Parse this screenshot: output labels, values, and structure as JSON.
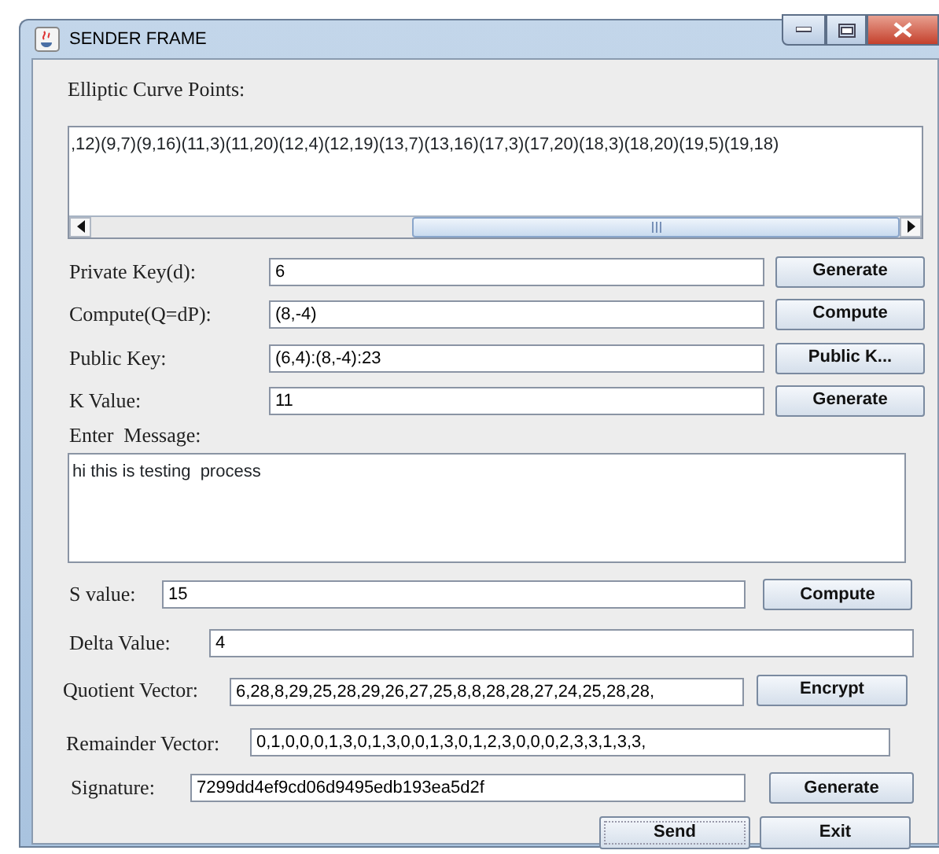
{
  "window": {
    "title": "SENDER FRAME"
  },
  "curve_points": {
    "label": "Elliptic Curve Points:",
    "value": ",12)(9,7)(9,16)(11,3)(11,20)(12,4)(12,19)(13,7)(13,16)(17,3)(17,20)(18,3)(18,20)(19,5)(19,18)"
  },
  "key_rows": [
    {
      "label": "Private Key(d):",
      "value": "6",
      "button": "Generate"
    },
    {
      "label": "Compute(Q=dP):",
      "value": "(8,-4)",
      "button": "Compute"
    },
    {
      "label": "Public Key:",
      "value": "(6,4):(8,-4):23",
      "button": "Public K..."
    },
    {
      "label": "K Value:",
      "value": "11",
      "button": "Generate"
    }
  ],
  "message": {
    "label": "Enter  Message:",
    "value": "hi this is testing  process"
  },
  "value_rows": [
    {
      "label": "S value:",
      "value": "15",
      "button": "Compute"
    },
    {
      "label": "Delta Value:",
      "value": "4"
    },
    {
      "label": "Quotient Vector:",
      "value": "6,28,8,29,25,28,29,26,27,25,8,8,28,28,27,24,25,28,28,",
      "button": "Encrypt"
    },
    {
      "label": "Remainder Vector:",
      "value": "0,1,0,0,0,1,3,0,1,3,0,0,1,3,0,1,2,3,0,0,0,2,3,3,1,3,3,"
    },
    {
      "label": "Signature:",
      "value": "7299dd4ef9cd06d9495edb193ea5d2f",
      "button": "Generate"
    }
  ],
  "actions": [
    {
      "label": "Send",
      "focused": true
    },
    {
      "label": "Exit",
      "focused": false
    }
  ]
}
